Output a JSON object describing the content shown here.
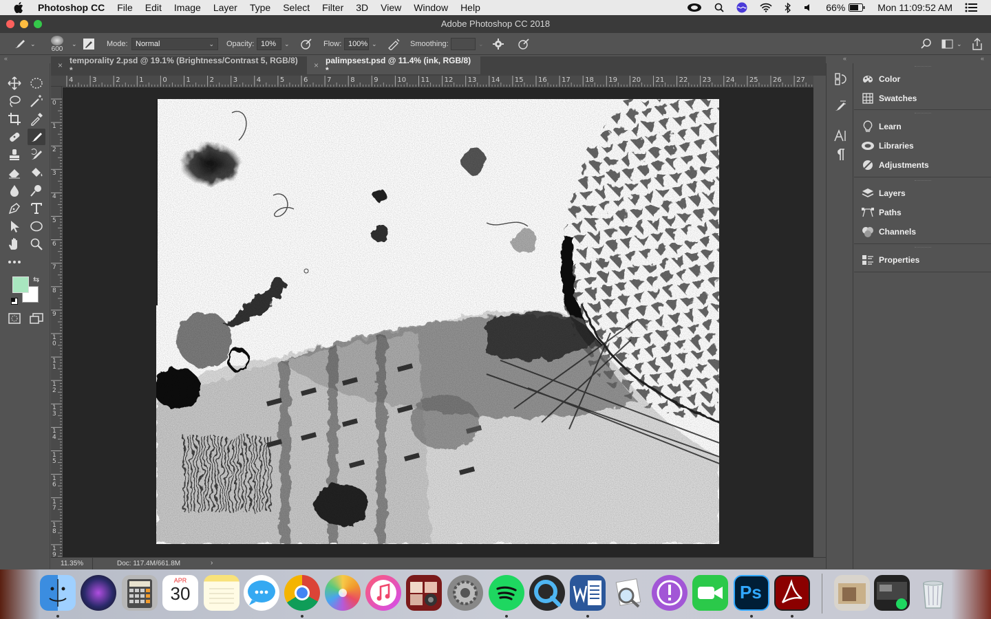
{
  "menubar": {
    "app_name": "Photoshop CC",
    "items": [
      "File",
      "Edit",
      "Image",
      "Layer",
      "Type",
      "Select",
      "Filter",
      "3D",
      "View",
      "Window",
      "Help"
    ],
    "battery": "66%",
    "clock": "Mon 11:09:52 AM"
  },
  "window": {
    "title": "Adobe Photoshop CC 2018"
  },
  "options": {
    "brush_size": "600",
    "mode_label": "Mode:",
    "mode_value": "Normal",
    "opacity_label": "Opacity:",
    "opacity_value": "10%",
    "flow_label": "Flow:",
    "flow_value": "100%",
    "smoothing_label": "Smoothing:",
    "smoothing_value": ""
  },
  "tabs": [
    {
      "label": "temporality 2.psd @ 19.1% (Brightness/Contrast 5, RGB/8) *",
      "active": false
    },
    {
      "label": "palimpsest.psd @ 11.4% (ink, RGB/8) *",
      "active": true
    }
  ],
  "ruler": {
    "h_labels": [
      "4",
      "3",
      "2",
      "1",
      "0",
      "1",
      "2",
      "3",
      "4",
      "5",
      "6",
      "7",
      "8",
      "9",
      "10",
      "11",
      "12",
      "13",
      "14",
      "15",
      "16",
      "17",
      "18",
      "19",
      "20",
      "21",
      "22",
      "23",
      "24",
      "25",
      "26",
      "27"
    ],
    "v_labels": [
      "0",
      "1",
      "2",
      "3",
      "4",
      "5",
      "6",
      "7",
      "8",
      "9",
      "10",
      "11",
      "12",
      "13",
      "14",
      "15",
      "16",
      "17",
      "18",
      "19"
    ]
  },
  "status": {
    "zoom": "11.35%",
    "doc": "Doc: 117.4M/661.8M"
  },
  "panels": {
    "group1": [
      "Color",
      "Swatches"
    ],
    "group2": [
      "Learn",
      "Libraries",
      "Adjustments"
    ],
    "group3": [
      "Layers",
      "Paths",
      "Channels"
    ],
    "group4": [
      "Properties"
    ]
  },
  "colors": {
    "foreground": "#a8e6bf",
    "background": "#ffffff",
    "ui_bg": "#535353",
    "canvas_bg": "#262626"
  },
  "dock": {
    "calendar_month": "APR",
    "calendar_day": "30",
    "apps": [
      "finder-icon",
      "siri-icon",
      "calculator-icon",
      "calendar-icon",
      "notes-icon",
      "messages-icon",
      "chrome-icon",
      "photos-icon",
      "itunes-icon",
      "photo-booth-icon",
      "system-preferences-icon",
      "spotify-icon",
      "quicktime-icon",
      "word-icon",
      "preview-icon",
      "feedback-icon",
      "facetime-icon",
      "photoshop-icon",
      "acrobat-icon",
      "downloads-icon",
      "recent-icon",
      "trash-icon"
    ]
  }
}
